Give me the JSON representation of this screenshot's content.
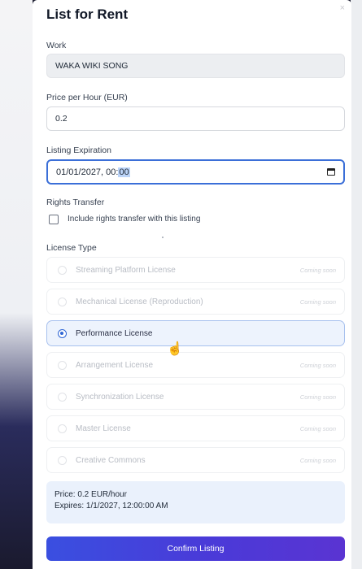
{
  "modal": {
    "title": "List for Rent",
    "close_glyph": "×"
  },
  "work": {
    "label": "Work",
    "value": "WAKA WIKI SONG"
  },
  "price": {
    "label": "Price per Hour (EUR)",
    "value": "0.2"
  },
  "expiration": {
    "label": "Listing Expiration",
    "value_prefix": "01/01/2027, 00:",
    "value_selected": "00",
    "icon": "calendar-icon"
  },
  "rights": {
    "label": "Rights Transfer",
    "checkbox_label": "Include rights transfer with this listing",
    "checked": false
  },
  "license": {
    "label": "License Type",
    "options": [
      {
        "label": "Streaming Platform License",
        "status": "Coming soon",
        "selected": false,
        "disabled": true
      },
      {
        "label": "Mechanical License (Reproduction)",
        "status": "Coming soon",
        "selected": false,
        "disabled": true
      },
      {
        "label": "Performance License",
        "status": "",
        "selected": true,
        "disabled": false
      },
      {
        "label": "Arrangement License",
        "status": "Coming soon",
        "selected": false,
        "disabled": true
      },
      {
        "label": "Synchronization License",
        "status": "Coming soon",
        "selected": false,
        "disabled": true
      },
      {
        "label": "Master License",
        "status": "Coming soon",
        "selected": false,
        "disabled": true
      },
      {
        "label": "Creative Commons",
        "status": "Coming soon",
        "selected": false,
        "disabled": true
      }
    ]
  },
  "summary": {
    "price_line": "Price: 0.2 EUR/hour",
    "expires_line": "Expires: 1/1/2027, 12:00:00 AM"
  },
  "confirm_label": "Confirm Listing",
  "colors": {
    "accent": "#3b6fd8",
    "button_start": "#3a4fe0",
    "button_end": "#5a34d2",
    "summary_bg": "#eaf1fc"
  }
}
